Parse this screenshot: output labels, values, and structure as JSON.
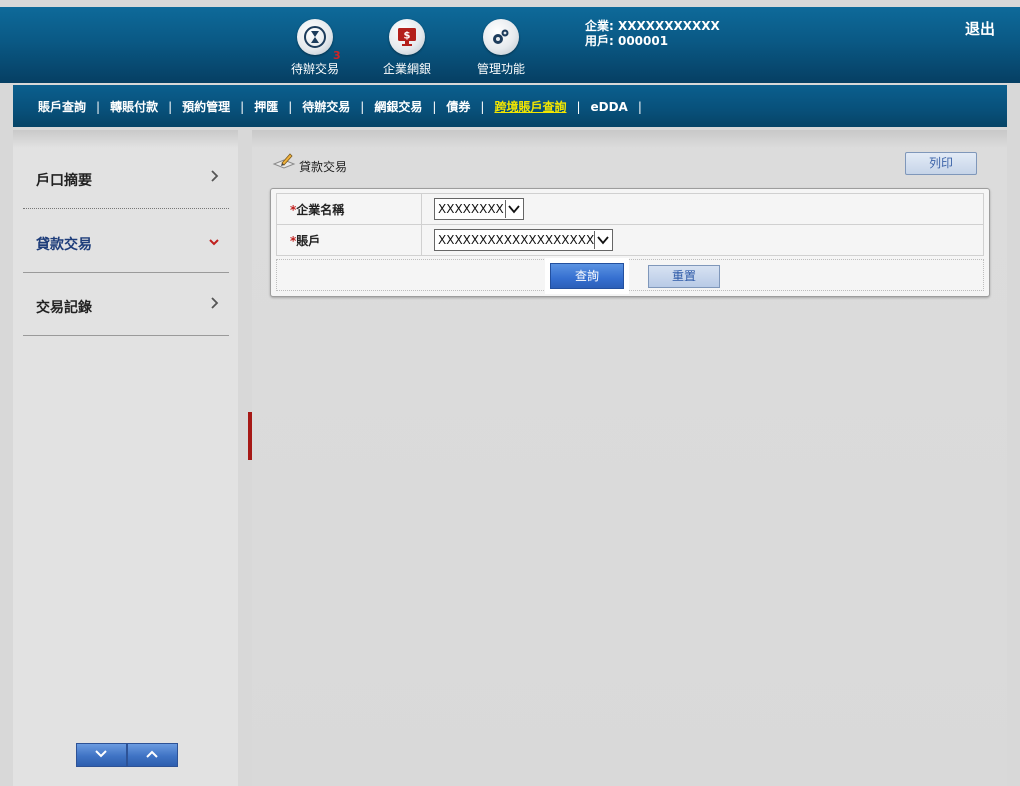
{
  "header": {
    "nav_icons": [
      {
        "label": "待辦交易",
        "icon": "hourglass-icon",
        "badge": "3"
      },
      {
        "label": "企業網銀",
        "icon": "monitor-dollar-icon"
      },
      {
        "label": "管理功能",
        "icon": "gears-icon"
      }
    ],
    "company_line": "企業: XXXXXXXXXXX",
    "user_line": "用戶: 000001",
    "logout": "退出"
  },
  "menu": {
    "items": [
      "賬戶查詢",
      "轉賬付款",
      "預約管理",
      "押匯",
      "待辦交易",
      "網銀交易",
      "債券",
      "跨境賬戶查詢",
      "eDDA"
    ],
    "separator": "|",
    "active": "跨境賬戶查詢"
  },
  "sidebar": {
    "items": [
      {
        "label": "戶口摘要",
        "state": "collapsed"
      },
      {
        "label": "貸款交易",
        "state": "expanded"
      },
      {
        "label": "交易記錄",
        "state": "collapsed"
      }
    ]
  },
  "main": {
    "title": "貸款交易",
    "print_label": "列印",
    "form": {
      "required_mark": "*",
      "company_label": "企業名稱",
      "company_value": "XXXXXXXX",
      "account_label": "賬戶",
      "account_value": "XXXXXXXXXXXXXXXXXXXXX",
      "query_label": "查詢",
      "reset_label": "重置"
    }
  },
  "colors": {
    "header_blue": "#0a5985",
    "active_menu": "#f2e600",
    "accent_red": "#c0201e",
    "button_blue": "#356fd0"
  }
}
